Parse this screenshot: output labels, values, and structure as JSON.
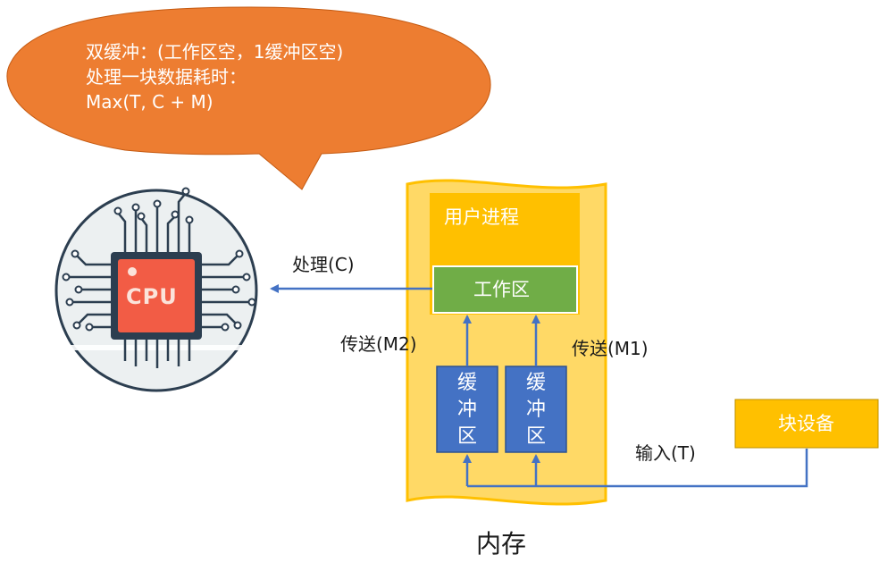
{
  "bubble": {
    "line1": "双缓冲：(工作区空，1缓冲区空)",
    "line2": "处理一块数据耗时：",
    "line3": "Max(T, C + M)"
  },
  "cpu": {
    "chip_label": "CPU"
  },
  "memory": {
    "user_process": "用户进程",
    "work_area": "工作区",
    "buffer_1": "缓冲区",
    "buffer_2": "缓冲区",
    "caption": "内存"
  },
  "device": {
    "label": "块设备"
  },
  "flows": {
    "process": "处理(C)",
    "transfer_m2": "传送(M2)",
    "transfer_m1": "传送(M1)",
    "input": "输入(T)"
  },
  "colors": {
    "bubble": "#ED7D31",
    "memory": "#FFD966",
    "user_process": "#FFC000",
    "work_area": "#70AD47",
    "buffer": "#4472C4",
    "device": "#FFC000",
    "arrow": "#4472C4",
    "cpu_chip": "#F25C45"
  }
}
